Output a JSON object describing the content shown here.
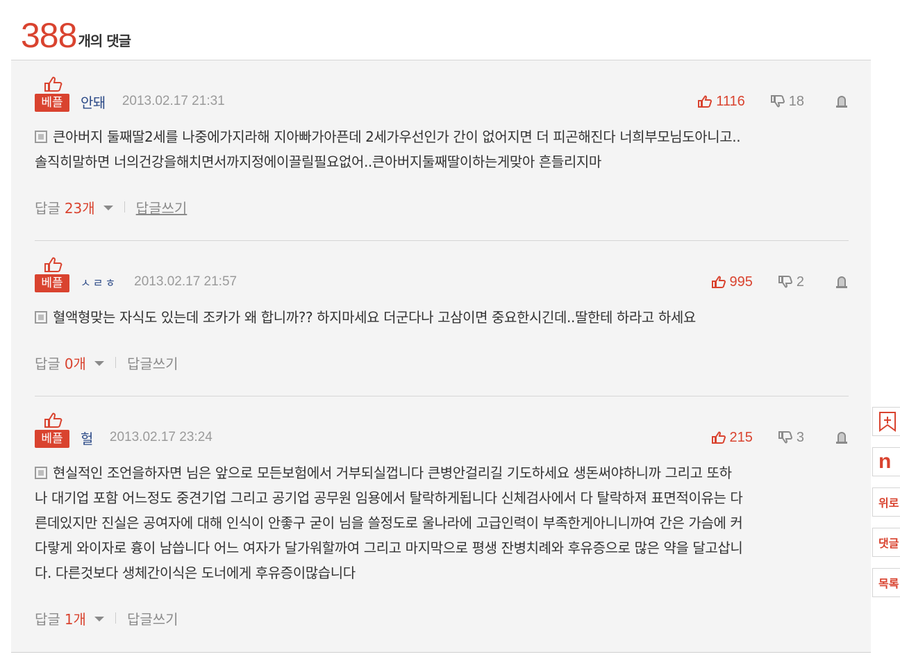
{
  "header": {
    "count": "388",
    "label": "개의 댓글"
  },
  "icons": {
    "best_thumb": "thumbs-up-icon",
    "vote_up": "thumbs-up-icon",
    "vote_down": "thumbs-down-icon",
    "report": "report-siren-icon",
    "comment_doc": "document-icon",
    "reply_toggle": "chevron-down-icon"
  },
  "colors": {
    "accent": "#d9432f",
    "author": "#2c4a87",
    "muted": "#9a9a9a",
    "list_bg": "#f4f4f4"
  },
  "comments": [
    {
      "badge": "베플",
      "author": "안돼",
      "date": "2013.02.17 21:31",
      "up": "1116",
      "down": "18",
      "lines": [
        "큰아버지 둘째딸2세를 나중에가지라해 지아빠가아픈데 2세가우선인가 간이 없어지면 더 피곤해진다 너희부모님도아니고..",
        "솔직히말하면 너의건강을해치면서까지정에이끌릴필요없어..큰아버지둘째딸이하는게맞아 흔들리지마"
      ],
      "reply_label": "답글",
      "reply_count": "23개",
      "write_label": "답글쓰기"
    },
    {
      "badge": "베플",
      "author": "ㅅㄹㅎ",
      "date": "2013.02.17 21:57",
      "up": "995",
      "down": "2",
      "lines": [
        "혈액형맞는 자식도 있는데 조카가 왜 합니까?? 하지마세요 더군다나 고삼이면 중요한시긴데..딸한테 하라고 하세요"
      ],
      "reply_label": "답글",
      "reply_count": "0개",
      "write_label": "답글쓰기"
    },
    {
      "badge": "베플",
      "author": "헐",
      "date": "2013.02.17 23:24",
      "up": "215",
      "down": "3",
      "lines": [
        "현실적인 조언을하자면 님은 앞으로 모든보험에서 거부되실껍니다 큰병안걸리길 기도하세요 생돈써야하니까 그리고 또하",
        "나 대기업 포함 어느정도 중견기업 그리고 공기업 공무원 임용에서 탈락하게됩니다 신체검사에서 다 탈락하져 표면적이유는 다",
        "른데있지만 진실은 공여자에 대해 인식이 안좋구 굳이 님을 쓸정도로 울나라에 고급인력이 부족한게아니니까여 간은 가슴에 커",
        "다랗게 와이자로 흉이 남씁니다 어느 여자가 달가워할까여 그리고 마지막으로 평생 잔병치례와 후유증으로 많은 약을 달고삽니",
        "다. 다른것보다 생체간이식은 도너에게 후유증이많습니다"
      ],
      "reply_label": "답글",
      "reply_count": "1개",
      "write_label": "답글쓰기"
    }
  ],
  "side_tools": [
    {
      "icon": "bookmark-add-icon",
      "label": ""
    },
    {
      "icon": "naver-n-icon",
      "label": "n"
    },
    {
      "icon": "",
      "label": "위로"
    },
    {
      "icon": "",
      "label": "댓글"
    },
    {
      "icon": "",
      "label": "목록"
    }
  ]
}
